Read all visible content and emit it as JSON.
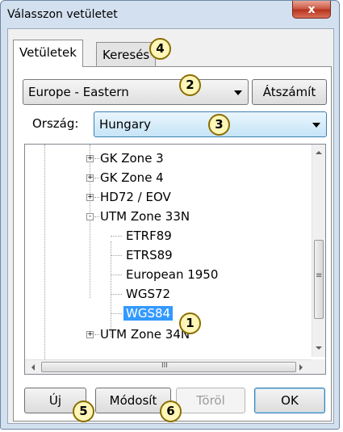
{
  "window": {
    "title": "Válasszon vetületet",
    "close_label": "x"
  },
  "tabs": [
    {
      "label": "Vetületek",
      "active": true
    },
    {
      "label": "Keresés",
      "active": false
    }
  ],
  "region": {
    "selected": "Europe - Eastern",
    "recalc_label": "Átszámít"
  },
  "country": {
    "label": "Ország:",
    "selected": "Hungary"
  },
  "tree": {
    "items": [
      {
        "label": "GK Zone 3",
        "level": 1,
        "expander": "+"
      },
      {
        "label": "GK Zone 4",
        "level": 1,
        "expander": "+"
      },
      {
        "label": "HD72 / EOV",
        "level": 1,
        "expander": "+"
      },
      {
        "label": "UTM Zone 33N",
        "level": 1,
        "expander": "-"
      },
      {
        "label": "ETRF89",
        "level": 2
      },
      {
        "label": "ETRS89",
        "level": 2
      },
      {
        "label": "European 1950",
        "level": 2
      },
      {
        "label": "WGS72",
        "level": 2
      },
      {
        "label": "WGS84",
        "level": 2,
        "selected": true
      },
      {
        "label": "UTM Zone 34N",
        "level": 1,
        "expander": "+"
      }
    ],
    "vscroll_grip": "≡",
    "hscroll_grip": "III"
  },
  "buttons": {
    "new_label": "Új",
    "modify_label": "Módosít",
    "delete_label": "Töröl",
    "ok_label": "OK"
  },
  "badges": [
    "1",
    "2",
    "3",
    "4",
    "5",
    "6"
  ]
}
